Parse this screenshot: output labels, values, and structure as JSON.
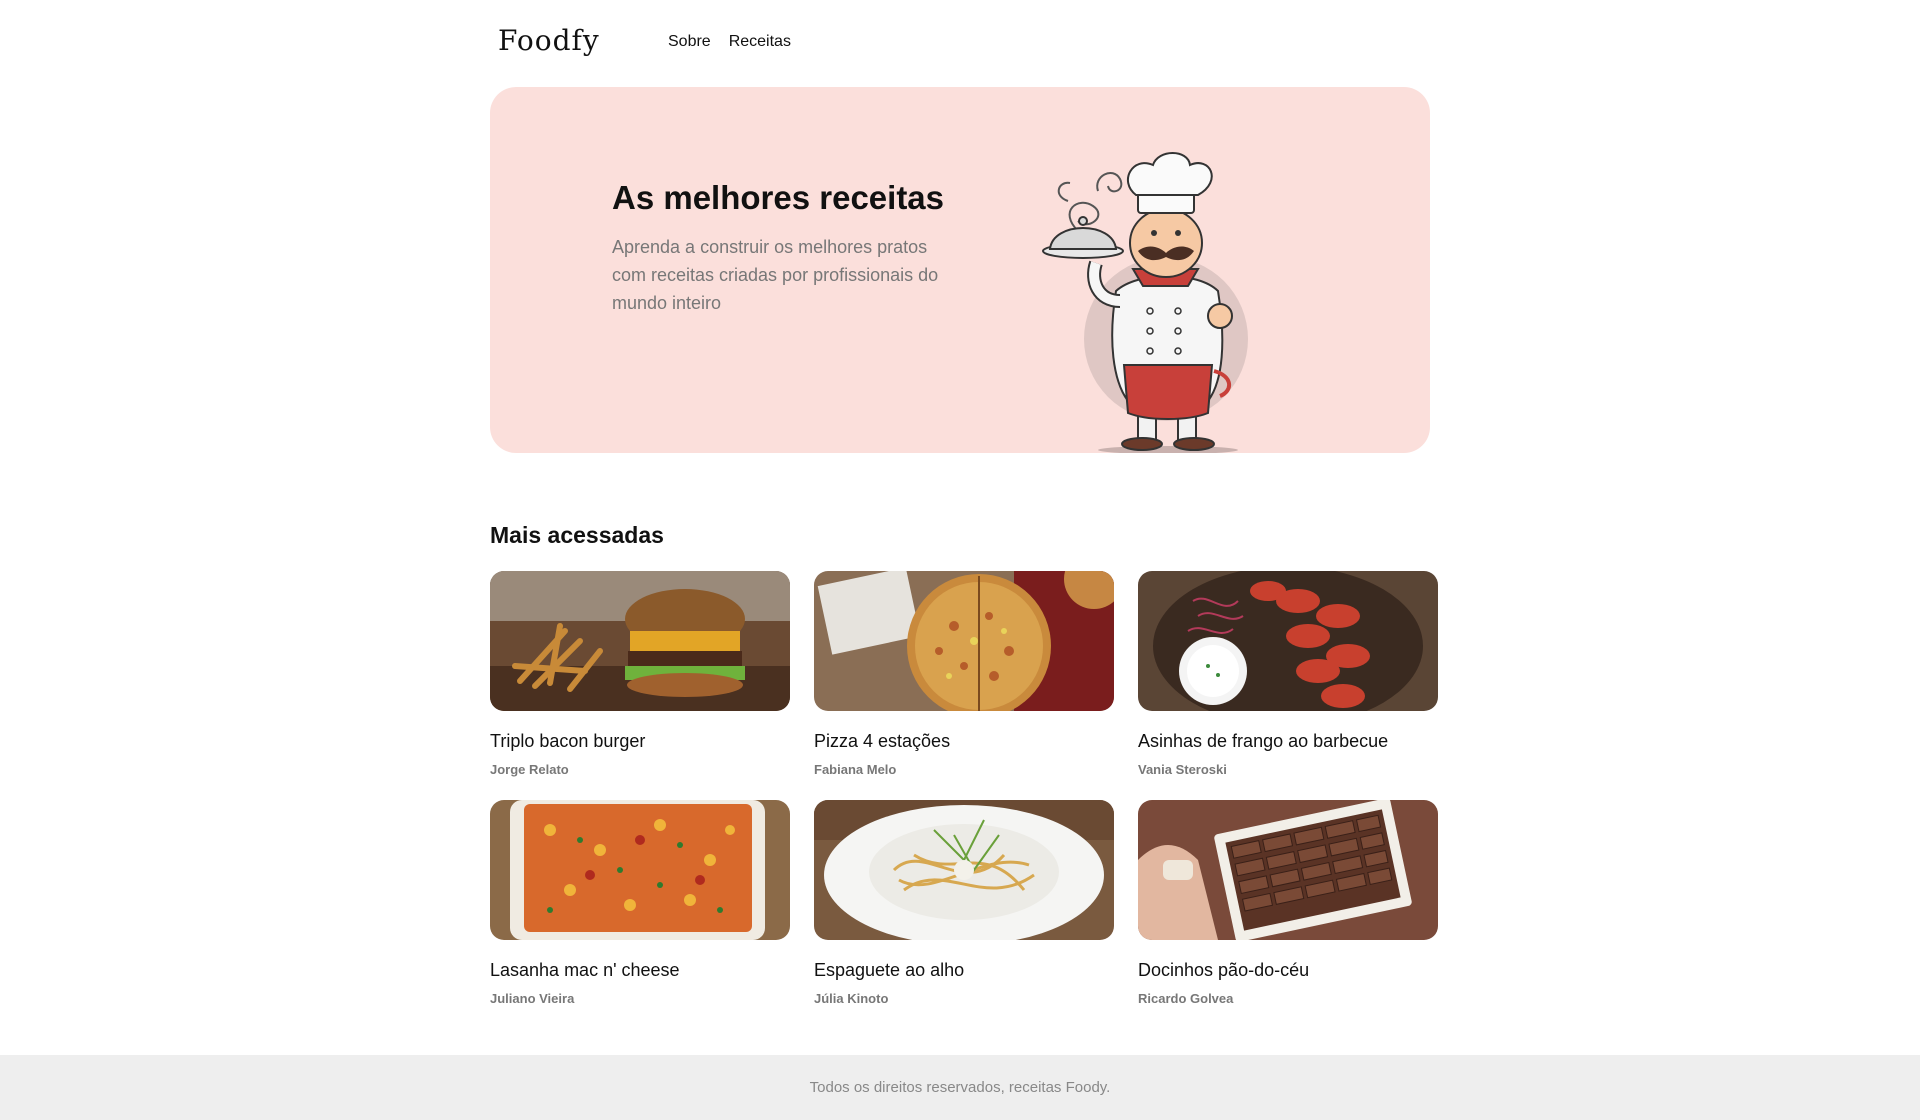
{
  "header": {
    "logo": "Foodfy",
    "nav": [
      {
        "label": "Sobre"
      },
      {
        "label": "Receitas"
      }
    ]
  },
  "hero": {
    "title": "As melhores receitas",
    "description": "Aprenda a construir os melhores pratos com receitas criadas por profissionais do mundo inteiro"
  },
  "section": {
    "title": "Mais acessadas",
    "recipes": [
      {
        "title": "Triplo bacon burger",
        "author": "Jorge Relato"
      },
      {
        "title": "Pizza 4 estações",
        "author": "Fabiana Melo"
      },
      {
        "title": "Asinhas de frango ao barbecue",
        "author": "Vania Steroski"
      },
      {
        "title": "Lasanha mac n' cheese",
        "author": "Juliano Vieira"
      },
      {
        "title": "Espaguete ao alho",
        "author": "Júlia Kinoto"
      },
      {
        "title": "Docinhos pão-do-céu",
        "author": "Ricardo Golvea"
      }
    ]
  },
  "footer": {
    "text": "Todos os direitos reservados, receitas Foody."
  },
  "colors": {
    "hero_background": "#fbdfdb",
    "muted_text": "#777777",
    "footer_background": "#eeeeee"
  }
}
